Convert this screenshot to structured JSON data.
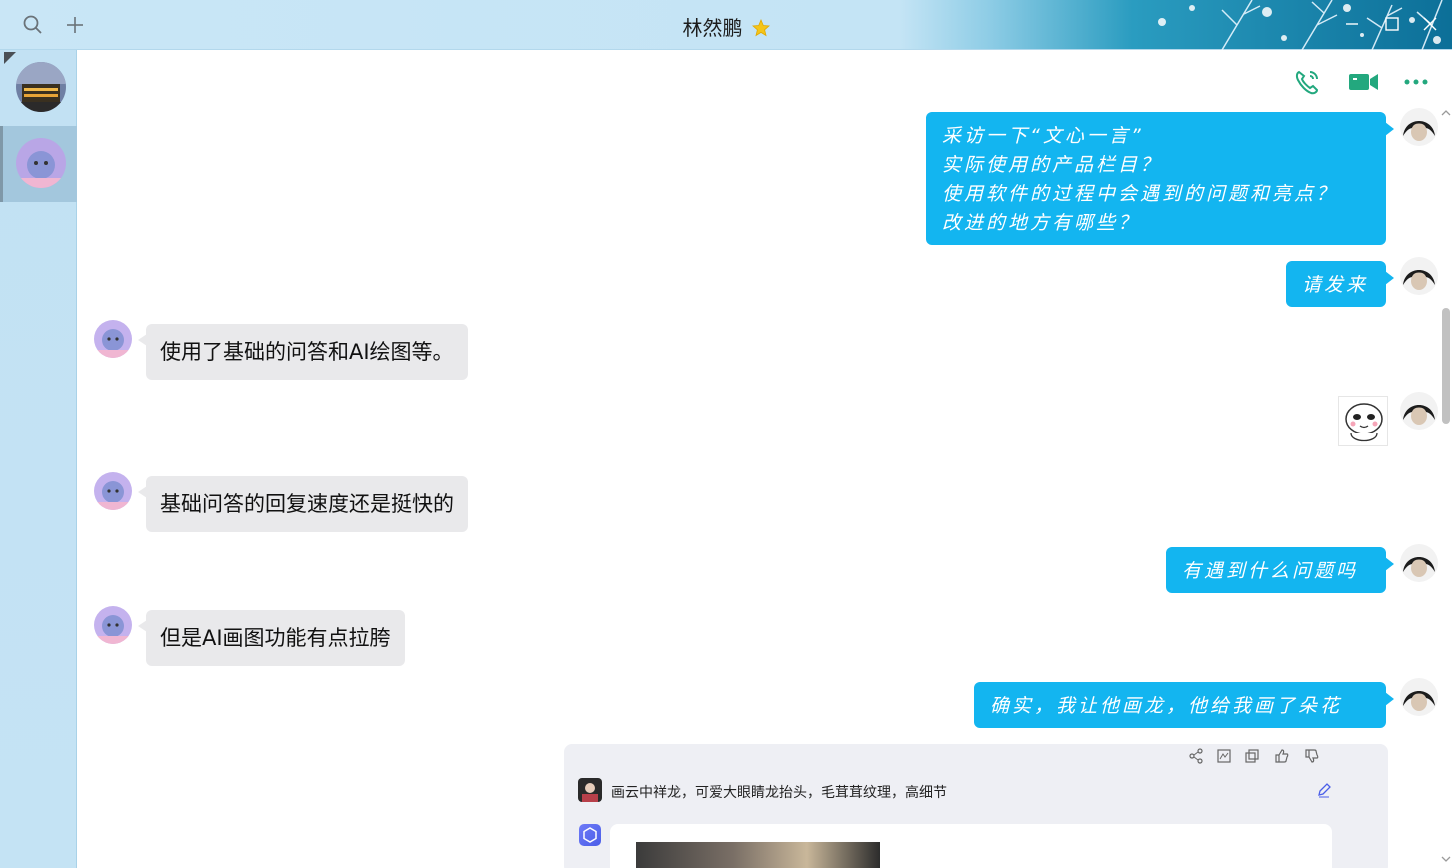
{
  "window": {
    "title": "林然鹏",
    "title_badge": "star-level-badge"
  },
  "toolbar": {
    "search_icon": "search-icon",
    "add_icon": "plus-icon"
  },
  "actions": {
    "voice_call": "phone-icon",
    "video_call": "video-camera-icon",
    "more": "more-dots-icon"
  },
  "messages": [
    {
      "side": "out",
      "text": "采访一下“文心一言”\n实际使用的产品栏目？\n使用软件的过程中会遇到的问题和亮点？\n改进的地方有哪些？"
    },
    {
      "side": "out",
      "text": "请发来"
    },
    {
      "side": "in",
      "text": "使用了基础的问答和AI绘图等。"
    },
    {
      "side": "out",
      "type": "sticker",
      "text": ""
    },
    {
      "side": "in",
      "text": "基础问答的回复速度还是挺快的"
    },
    {
      "side": "out",
      "text": "有遇到什么问题吗"
    },
    {
      "side": "in",
      "text": "但是AI画图功能有点拉胯"
    },
    {
      "side": "out",
      "text": "确实，我让他画龙，他给我画了朵花"
    }
  ],
  "shared_card": {
    "prompt": "画云中祥龙，可爱大眼睛龙抬头，毛茸茸纹理，高细节",
    "tools": [
      "share-icon",
      "image-icon",
      "copy-icon",
      "thumbs-up-icon",
      "thumbs-down-icon"
    ]
  },
  "colors": {
    "outgoing_bubble": "#13b5f0",
    "incoming_bubble": "#e9e9eb",
    "action_icon": "#23a87e"
  }
}
